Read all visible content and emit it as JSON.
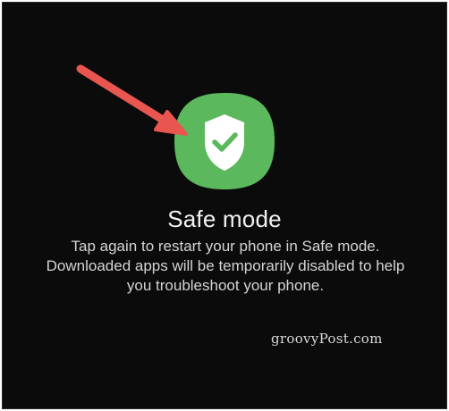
{
  "dialog": {
    "title": "Safe mode",
    "description_lines": [
      "Tap again to restart your phone in Safe mode.",
      "Downloaded apps will be temporarily disabled to help",
      "you troubleshoot your phone."
    ]
  },
  "icons": {
    "main": "shield-check-icon",
    "annotation": "red-arrow-icon"
  },
  "watermark": "groovyPost.com",
  "colors": {
    "background": "#0b0b0b",
    "icon_green": "#5cb85c",
    "shield_white": "#ffffff",
    "arrow_red": "#e8564f",
    "text": "#f2f2f2"
  }
}
